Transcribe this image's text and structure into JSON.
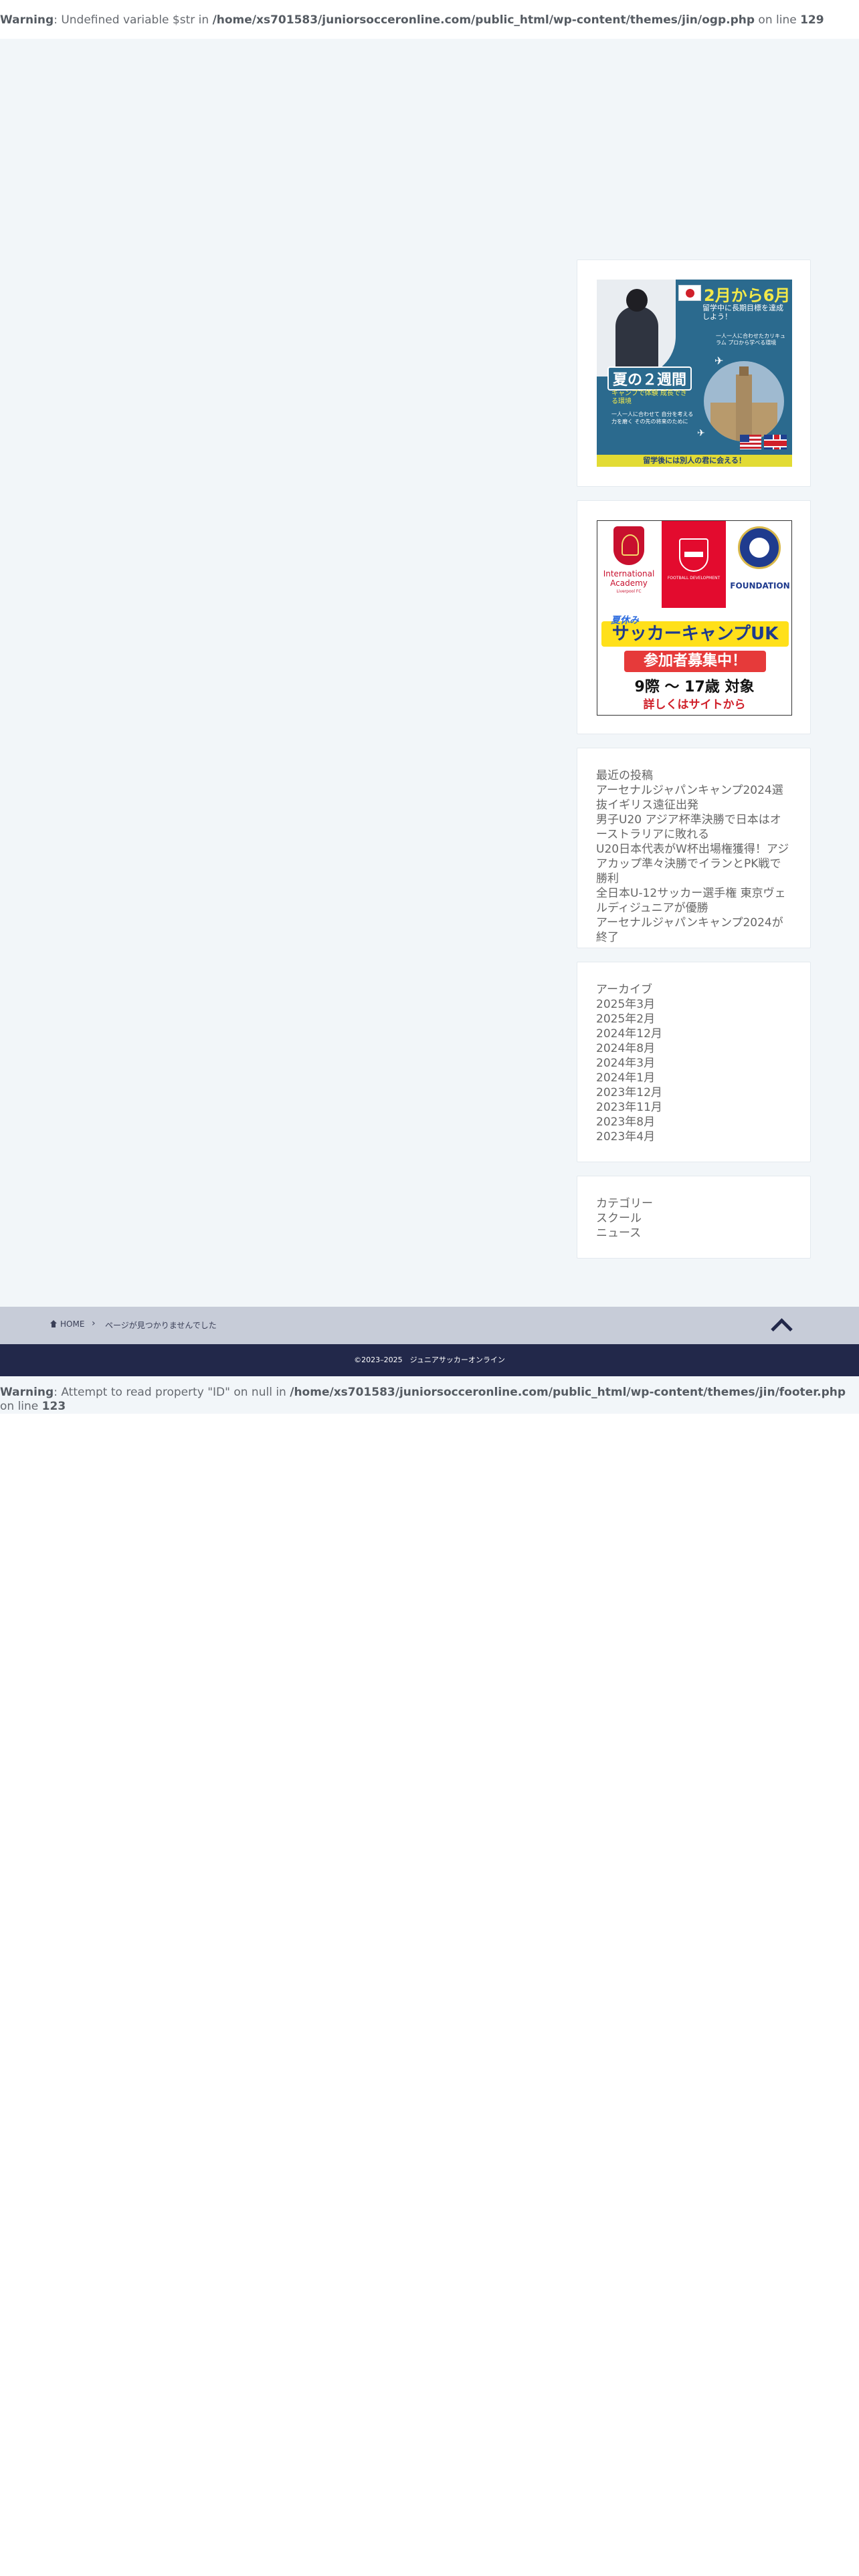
{
  "warning_top": {
    "label": "Warning",
    "message": ": Undefined variable $str in ",
    "path": "/home/xs701583/juniorsocceronline.com/public_html/wp-content/themes/jin/ogp.php",
    "on_line": " on line ",
    "line": "129"
  },
  "banner1": {
    "headline": "2月から6月",
    "subhead": "留学中に長期目標を達成しよう！",
    "lines": "一人一人に合わせたカリキュラム プロから学べる環境",
    "summer": "夏の２週間",
    "summer_sub": "キャンプで体験 成長できる環境",
    "summer_lines": "一人一人に合わせて 自分を考える力を磨く その先の将来のために",
    "footer": "留学後には別人の君に会える！"
  },
  "banner2": {
    "club1_name": "International Academy",
    "club1_sub": "Liverpool FC",
    "club2_name": "FOOTBALL DEVELOPMENT",
    "club3_name": "FOUNDATION",
    "summer_tag": "夏休み",
    "camp": "サッカーキャンプUK",
    "recruit": "参加者募集中！",
    "age": "9際 〜 17歳 対象",
    "detail": "詳しくはサイトから"
  },
  "recent_posts": {
    "title": "最近の投稿",
    "items": [
      "アーセナルジャパンキャンプ2024選抜イギリス遠征出発",
      "男子U20 アジア杯準決勝で日本はオーストラリアに敗れる",
      "U20日本代表がW杯出場権獲得！アジアカップ準々決勝でイランとPK戦で勝利",
      "全日本U-12サッカー選手権 東京ヴェルディジュニアが優勝",
      "アーセナルジャパンキャンプ2024が終了"
    ]
  },
  "archives": {
    "title": "アーカイブ",
    "items": [
      "2025年3月",
      "2025年2月",
      "2024年12月",
      "2024年8月",
      "2024年3月",
      "2024年1月",
      "2023年12月",
      "2023年11月",
      "2023年8月",
      "2023年4月"
    ]
  },
  "categories": {
    "title": "カテゴリー",
    "items": [
      "スクール",
      "ニュース"
    ]
  },
  "breadcrumb": {
    "home": "HOME",
    "separator": "›",
    "current": "ページが見つかりませんでした"
  },
  "footer": {
    "copyright": "©2023–2025　ジュニアサッカーオンライン"
  },
  "warning_bottom": {
    "label": "Warning",
    "message": ": Attempt to read property \"ID\" on null in ",
    "path": "/home/xs701583/juniorsocceronline.com/public_html/wp-content/themes/jin/footer.php",
    "on_line": " on line ",
    "line": "123"
  }
}
